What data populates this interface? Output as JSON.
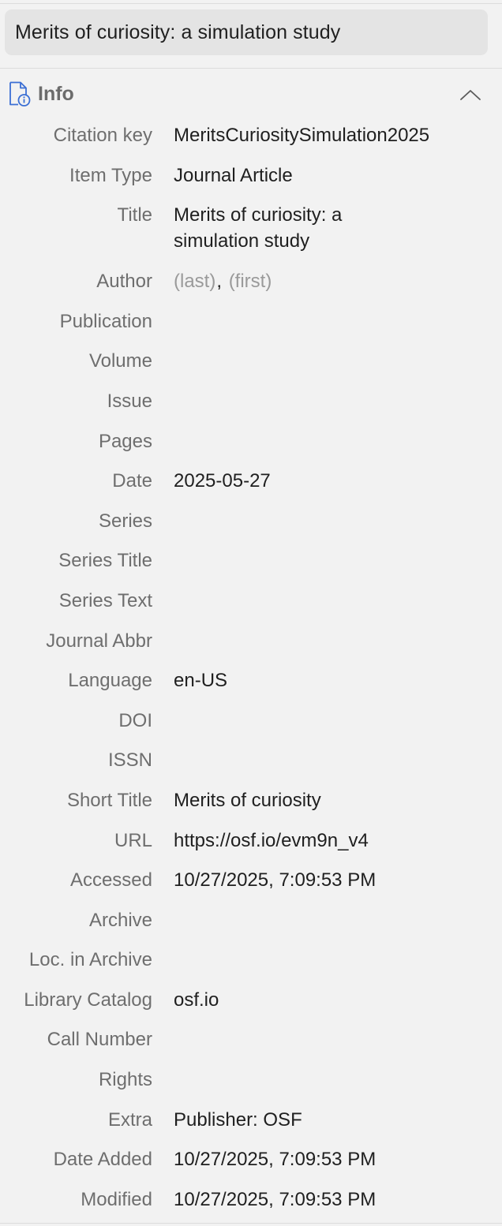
{
  "title": "Merits of curiosity: a simulation study",
  "section": {
    "label": "Info",
    "icon": "document-info-icon",
    "collapse_icon": "chevron-up-icon"
  },
  "fields": {
    "citation_key": {
      "label": "Citation key",
      "value": "MeritsCuriositySimulation2025"
    },
    "item_type": {
      "label": "Item Type",
      "value": "Journal Article"
    },
    "title": {
      "label": "Title",
      "value": "Merits of curiosity: a simulation study"
    },
    "author": {
      "label": "Author",
      "last_placeholder": "(last)",
      "separator": ",",
      "first_placeholder": "(first)"
    },
    "publication": {
      "label": "Publication",
      "value": ""
    },
    "volume": {
      "label": "Volume",
      "value": ""
    },
    "issue": {
      "label": "Issue",
      "value": ""
    },
    "pages": {
      "label": "Pages",
      "value": ""
    },
    "date": {
      "label": "Date",
      "value": "2025-05-27"
    },
    "series": {
      "label": "Series",
      "value": ""
    },
    "series_title": {
      "label": "Series Title",
      "value": ""
    },
    "series_text": {
      "label": "Series Text",
      "value": ""
    },
    "journal_abbr": {
      "label": "Journal Abbr",
      "value": ""
    },
    "language": {
      "label": "Language",
      "value": "en-US"
    },
    "doi": {
      "label": "DOI",
      "value": ""
    },
    "issn": {
      "label": "ISSN",
      "value": ""
    },
    "short_title": {
      "label": "Short Title",
      "value": "Merits of curiosity"
    },
    "url": {
      "label": "URL",
      "value": "https://osf.io/evm9n_v4"
    },
    "accessed": {
      "label": "Accessed",
      "value": "10/27/2025, 7:09:53 PM"
    },
    "archive": {
      "label": "Archive",
      "value": ""
    },
    "loc_in_archive": {
      "label": "Loc. in Archive",
      "value": ""
    },
    "library_catalog": {
      "label": "Library Catalog",
      "value": "osf.io"
    },
    "call_number": {
      "label": "Call Number",
      "value": ""
    },
    "rights": {
      "label": "Rights",
      "value": ""
    },
    "extra": {
      "label": "Extra",
      "value": "Publisher: OSF"
    },
    "date_added": {
      "label": "Date Added",
      "value": "10/27/2025, 7:09:53 PM"
    },
    "modified": {
      "label": "Modified",
      "value": "10/27/2025, 7:09:53 PM"
    }
  },
  "colors": {
    "background": "#f2f2f2",
    "title_box": "#e4e4e4",
    "label_text": "#6e6e6e",
    "value_text": "#1f1f1f",
    "placeholder_text": "#9a9a9a",
    "icon_accent": "#3b6fd4"
  }
}
